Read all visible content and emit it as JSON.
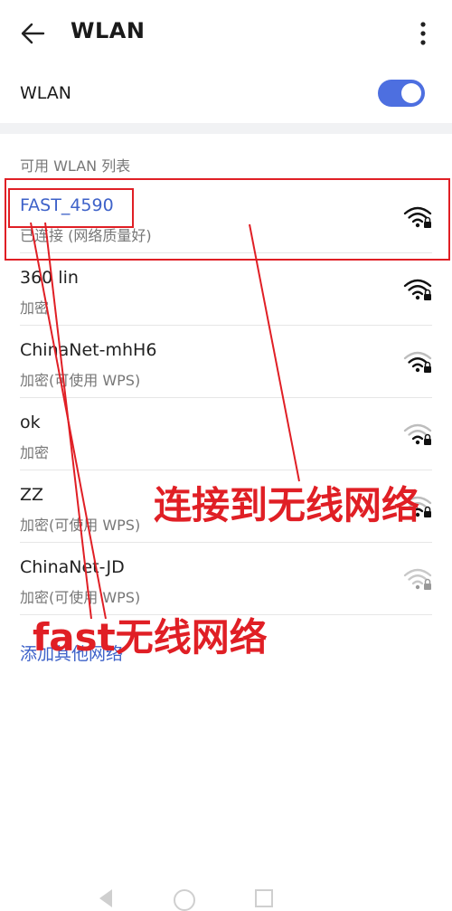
{
  "header": {
    "title": "WLAN",
    "back_icon": "back-arrow-icon",
    "menu_icon": "more-vertical-icon"
  },
  "wlan_toggle": {
    "label": "WLAN",
    "enabled": true,
    "accent_color": "#4d6fe0"
  },
  "section_header": "可用 WLAN 列表",
  "networks": [
    {
      "name": "FAST_4590",
      "status": "已连接 (网络质量好)",
      "connected": true,
      "signal": "full",
      "locked": true
    },
    {
      "name": "360 lin",
      "status": "加密",
      "connected": false,
      "signal": "full",
      "locked": true
    },
    {
      "name": "ChinaNet-mhH6",
      "status": "加密(可使用 WPS)",
      "connected": false,
      "signal": "strong",
      "locked": true
    },
    {
      "name": "ok",
      "status": "加密",
      "connected": false,
      "signal": "medium",
      "locked": true
    },
    {
      "name": "ZZ",
      "status": "加密(可使用 WPS)",
      "connected": false,
      "signal": "medium",
      "locked": true
    },
    {
      "name": "ChinaNet-JD",
      "status": "加密(可使用 WPS)",
      "connected": false,
      "signal": "weak",
      "locked": true
    }
  ],
  "add_network_label": "添加其他网络",
  "annotations": {
    "connect_label": "连接到无线网络",
    "fast_label": "fast无线网络",
    "color": "#e01f25"
  }
}
